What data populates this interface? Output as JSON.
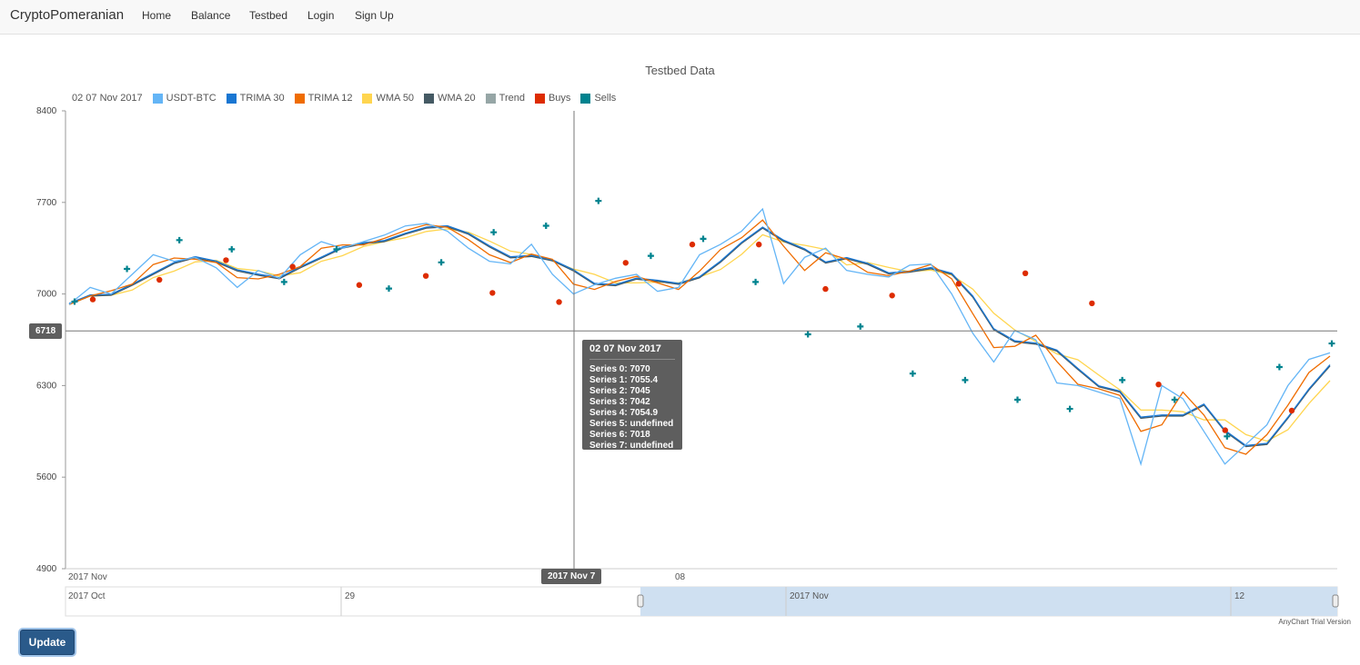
{
  "nav": {
    "brand": "CryptoPomeranian",
    "links": [
      "Home",
      "Balance",
      "Testbed",
      "Login",
      "Sign Up"
    ]
  },
  "chart": {
    "title": "Testbed Data",
    "legend_date": "02 07 Nov 2017",
    "legend": [
      {
        "name": "USDT-BTC",
        "color": "#64b5f6"
      },
      {
        "name": "TRIMA 30",
        "color": "#1976d2"
      },
      {
        "name": "TRIMA 12",
        "color": "#ef6c00"
      },
      {
        "name": "WMA 50",
        "color": "#ffd54f"
      },
      {
        "name": "WMA 20",
        "color": "#455a64"
      },
      {
        "name": "Trend",
        "color": "#96a6a6"
      },
      {
        "name": "Buys",
        "color": "#dd2c00"
      },
      {
        "name": "Sells",
        "color": "#00838f"
      }
    ],
    "crosshair_y_label": "6718",
    "crosshair_x_label": "2017 Nov 7",
    "tooltip": {
      "title": "02 07 Nov 2017",
      "lines": [
        "Series 0: 7070",
        "Series 1: 7055.4",
        "Series 2: 7045",
        "Series 3: 7042",
        "Series 4: 7054.9",
        "Series 5: undefined",
        "Series 6: 7018",
        "Series 7: undefined"
      ]
    },
    "x_axis_labels": [
      "2017 Nov",
      "08"
    ],
    "scroller_labels": [
      "2017 Oct",
      "29",
      "2017 Nov",
      "12"
    ],
    "watermark": "AnyChart Trial Version"
  },
  "chart_data": {
    "type": "line",
    "title": "Testbed Data",
    "yticks": [
      4900,
      5600,
      6300,
      7000,
      7700,
      8400
    ],
    "ylim": [
      4900,
      8400
    ],
    "series": [
      {
        "name": "USDT-BTC",
        "values": [
          6920,
          7050,
          7000,
          7150,
          7300,
          7250,
          7280,
          7200,
          7050,
          7180,
          7120,
          7300,
          7400,
          7350,
          7400,
          7450,
          7520,
          7540,
          7480,
          7350,
          7250,
          7230,
          7380,
          7150,
          7000,
          7070,
          7120,
          7150,
          7020,
          7050,
          7300,
          7380,
          7480,
          7650,
          7080,
          7280,
          7350,
          7180,
          7150,
          7130,
          7220,
          7230,
          7000,
          6700,
          6480,
          6720,
          6650,
          6320,
          6300,
          6250,
          6200,
          5700,
          6300,
          6200,
          5950,
          5700,
          5850,
          6000,
          6300,
          6500,
          6550
        ]
      },
      {
        "name": "Buys",
        "values": [
          7000,
          7150,
          7300,
          7250,
          7110,
          7180,
          7050,
          6980,
          7280,
          7420,
          7420,
          7080,
          7030,
          7120,
          7200,
          6970,
          6350,
          6000,
          6150
        ]
      },
      {
        "name": "Sells",
        "values": [
          6900,
          7150,
          7370,
          7300,
          7050,
          7300,
          7000,
          7200,
          7430,
          7480,
          7670,
          7250,
          7380,
          7050,
          6650,
          6710,
          6350,
          6300,
          6150,
          6080,
          6300,
          6150,
          5870,
          6400,
          6580
        ]
      }
    ]
  }
}
